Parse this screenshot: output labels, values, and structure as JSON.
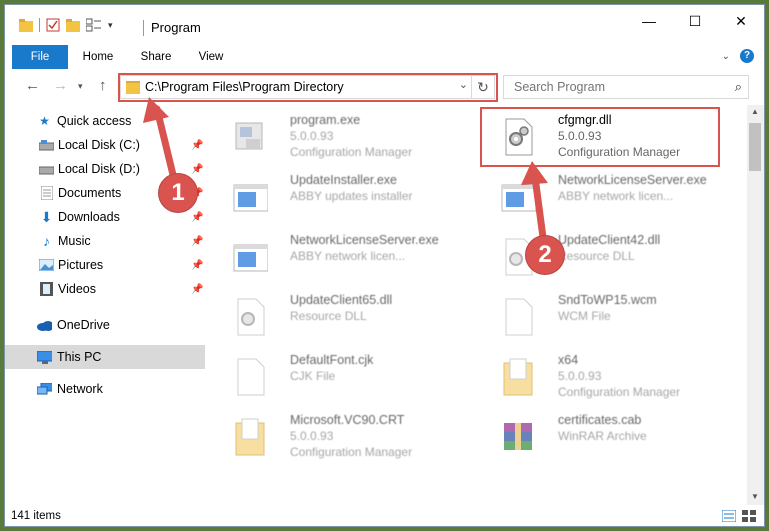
{
  "window": {
    "title": "Program"
  },
  "ribbon": {
    "tabs": [
      "File",
      "Home",
      "Share",
      "View"
    ]
  },
  "address": {
    "path": "C:\\Program Files\\Program Directory"
  },
  "search": {
    "placeholder": "Search Program"
  },
  "sidebar": {
    "items": [
      {
        "label": "Quick access",
        "icon": "star-icon",
        "pinned": false
      },
      {
        "label": "Local Disk (C:)",
        "icon": "drive-icon",
        "pinned": true
      },
      {
        "label": "Local Disk (D:)",
        "icon": "drive-icon",
        "pinned": true
      },
      {
        "label": "Documents",
        "icon": "documents-icon",
        "pinned": true
      },
      {
        "label": "Downloads",
        "icon": "download-icon",
        "pinned": true
      },
      {
        "label": "Music",
        "icon": "music-icon",
        "pinned": true
      },
      {
        "label": "Pictures",
        "icon": "pictures-icon",
        "pinned": true
      },
      {
        "label": "Videos",
        "icon": "videos-icon",
        "pinned": true
      },
      {
        "label": "OneDrive",
        "icon": "cloud-icon",
        "pinned": false
      },
      {
        "label": "This PC",
        "icon": "computer-icon",
        "pinned": false,
        "selected": true
      },
      {
        "label": "Network",
        "icon": "network-icon",
        "pinned": false
      }
    ]
  },
  "files": [
    {
      "name": "program.exe",
      "line2": "5.0.0.93",
      "line3": "Configuration Manager",
      "icon": "exe-icon"
    },
    {
      "name": "cfgmgr.dll",
      "line2": "5.0.0.93",
      "line3": "Configuration Manager",
      "icon": "dll-gear-icon"
    },
    {
      "name": "UpdateInstaller.exe",
      "line2": "ABBY updates installer",
      "line3": "",
      "icon": "window-icon"
    },
    {
      "name": "NetworkLicenseServer.exe",
      "line2": "ABBY network licen...",
      "line3": "",
      "icon": "window-icon"
    },
    {
      "name": "NetworkLicenseServer.exe",
      "line2": "ABBY network licen...",
      "line3": "",
      "icon": "window-icon"
    },
    {
      "name": "UpdateClient42.dll",
      "line2": "Resource DLL",
      "line3": "",
      "icon": "dll-gear-icon"
    },
    {
      "name": "UpdateClient65.dll",
      "line2": "Resource DLL",
      "line3": "",
      "icon": "dll-gear-icon"
    },
    {
      "name": "SndToWP15.wcm",
      "line2": "WCM File",
      "line3": "",
      "icon": "blank-file-icon"
    },
    {
      "name": "DefaultFont.cjk",
      "line2": "CJK File",
      "line3": "",
      "icon": "blank-file-icon"
    },
    {
      "name": "x64",
      "line2": "5.0.0.93",
      "line3": "Configuration Manager",
      "icon": "folder-doc-icon"
    },
    {
      "name": "Microsoft.VC90.CRT",
      "line2": "5.0.0.93",
      "line3": "Configuration Manager",
      "icon": "folder-doc-icon"
    },
    {
      "name": "certificates.cab",
      "line2": "WinRAR Archive",
      "line3": "",
      "icon": "archive-icon"
    }
  ],
  "annotations": {
    "badge1": "1",
    "badge2": "2"
  },
  "status": {
    "count": "141 items"
  },
  "colors": {
    "accent": "#1979ca",
    "highlight": "#d9534f",
    "selected": "#cce8ff"
  }
}
